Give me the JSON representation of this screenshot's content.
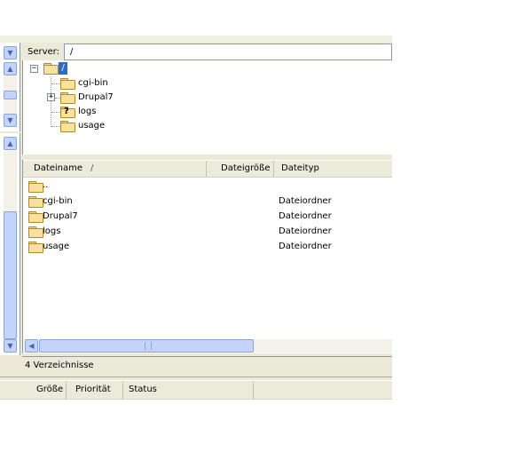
{
  "server": {
    "label": "Server:",
    "path": "/"
  },
  "tree": {
    "root_label": "/",
    "items": [
      {
        "label": "cgi-bin",
        "icon": "folder-icon"
      },
      {
        "label": "Drupal7",
        "icon": "folder-icon",
        "expander": "+"
      },
      {
        "label": "logs",
        "icon": "folder-unknown-icon"
      },
      {
        "label": "usage",
        "icon": "folder-icon"
      }
    ],
    "root_expander": "−"
  },
  "columns": {
    "name": "Dateiname",
    "sort_indicator": "/",
    "size": "Dateigröße",
    "type": "Dateityp"
  },
  "files": [
    {
      "name": "..",
      "type": ""
    },
    {
      "name": "cgi-bin",
      "type": "Dateiordner"
    },
    {
      "name": "Drupal7",
      "type": "Dateiordner"
    },
    {
      "name": "logs",
      "type": "Dateiordner"
    },
    {
      "name": "usage",
      "type": "Dateiordner"
    }
  ],
  "status": {
    "text": "4 Verzeichnisse"
  },
  "queue_columns": {
    "size": "Größe",
    "priority": "Priorität",
    "status": "Status"
  },
  "colors": {
    "panel": "#ece9d8",
    "scroll_thumb": "#c4d3fa",
    "selection": "#316ac5"
  }
}
